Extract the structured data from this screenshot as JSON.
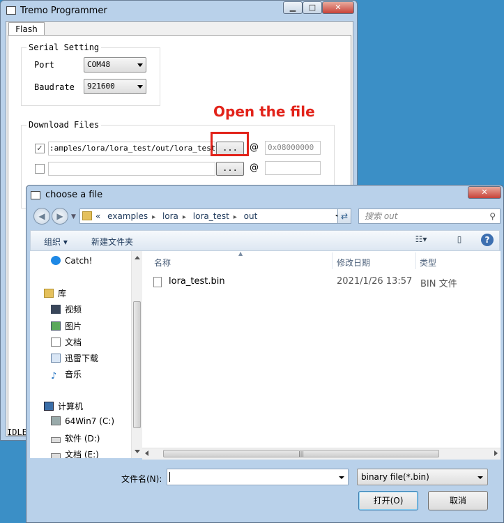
{
  "main_window": {
    "title": "Tremo Programmer",
    "tab": "Flash",
    "serial": {
      "group_title": "Serial Setting",
      "port_label": "Port",
      "port_value": "COM48",
      "baud_label": "Baudrate",
      "baud_value": "921600"
    },
    "download": {
      "group_title": "Download Files",
      "rows": [
        {
          "checked": "✓",
          "path": ":amples/lora/lora_test/out/lora_test.bin",
          "browse": "...",
          "at": "@",
          "addr": "0x08000000"
        },
        {
          "checked": "",
          "path": "",
          "browse": "...",
          "at": "@",
          "addr": ""
        }
      ]
    },
    "annotation": "Open the file",
    "status": "IDLE"
  },
  "dialog": {
    "title": "choose a file",
    "breadcrumb": [
      "«",
      "examples",
      "lora",
      "lora_test",
      "out"
    ],
    "search_placeholder": "搜索 out",
    "toolbar": {
      "organize": "组织 ▾",
      "new_folder": "新建文件夹"
    },
    "nav": [
      {
        "label": "Catch!",
        "icon": "catch-icon"
      },
      {
        "label": "库",
        "icon": "library-icon"
      },
      {
        "label": "视频",
        "icon": "video-icon"
      },
      {
        "label": "图片",
        "icon": "picture-icon"
      },
      {
        "label": "文档",
        "icon": "document-icon"
      },
      {
        "label": "迅雷下载",
        "icon": "download-icon"
      },
      {
        "label": "音乐",
        "icon": "music-icon"
      },
      {
        "label": "计算机",
        "icon": "computer-icon"
      },
      {
        "label": "64Win7  (C:)",
        "icon": "drive-c-icon"
      },
      {
        "label": "软件 (D:)",
        "icon": "drive-icon"
      },
      {
        "label": "文档 (E:)",
        "icon": "drive-icon"
      }
    ],
    "columns": {
      "name": "名称",
      "modified": "修改日期",
      "type": "类型"
    },
    "files": [
      {
        "name": "lora_test.bin",
        "modified": "2021/1/26 13:57",
        "type": "BIN 文件"
      }
    ],
    "filename_label": "文件名(N):",
    "filename_value": "",
    "filter": "binary file(*.bin)",
    "open_button": "打开(O)",
    "cancel_button": "取消"
  }
}
